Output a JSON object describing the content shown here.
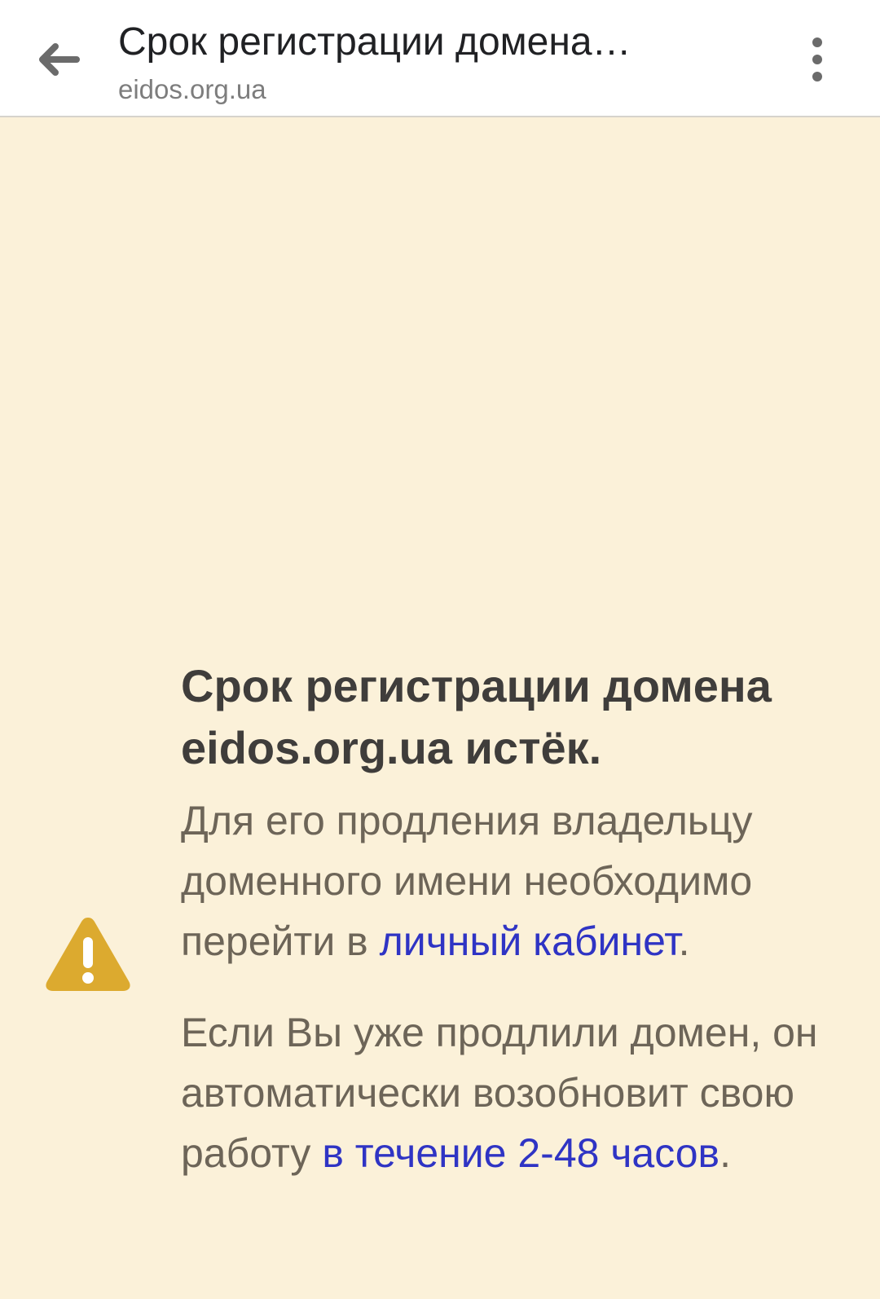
{
  "toolbar": {
    "title": "Срок регистрации домена…",
    "url": "eidos.org.ua"
  },
  "notice": {
    "headline": "Срок регистрации домена eidos.org.ua истёк.",
    "para1_before": "Для его продления владельцу доменного имени необходимо перейти в ",
    "para1_link": "личный кабинет",
    "para1_after": ".",
    "para2_before": "Если Вы уже продлили домен, он автоматически возобновит свою работу ",
    "para2_link": "в течение 2-48 часов",
    "para2_after": "."
  },
  "colors": {
    "background": "#fbf1d9",
    "warning_icon": "#dcaa2f",
    "link": "#2f34c4"
  },
  "icons": [
    "arrow-left-icon",
    "more-vert-icon",
    "warning-icon"
  ]
}
